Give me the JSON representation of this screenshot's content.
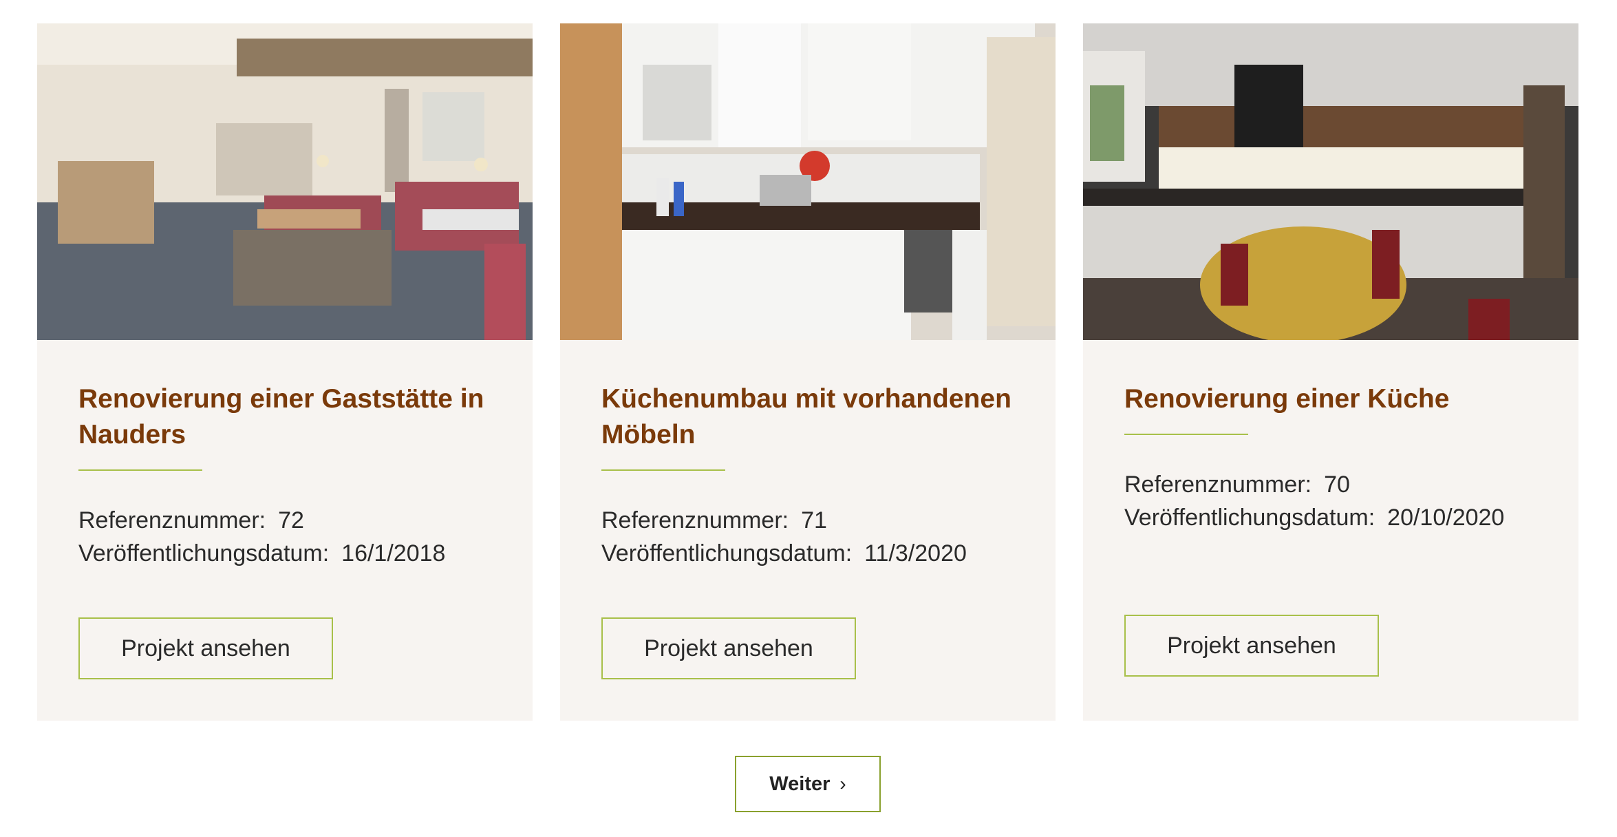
{
  "projects": [
    {
      "title": "Renovierung einer Gaststätte in Nauders",
      "ref_label": "Referenznummer:",
      "ref_value": "72",
      "date_label": "Veröffentlichungsdatum:",
      "date_value": "16/1/2018",
      "button_label": "Projekt ansehen",
      "image_icon": "restaurant-interior-photo"
    },
    {
      "title": "Küchenumbau mit vorhandenen Möbeln",
      "ref_label": "Referenznummer:",
      "ref_value": "71",
      "date_label": "Veröffentlichungsdatum:",
      "date_value": "11/3/2020",
      "button_label": "Projekt ansehen",
      "image_icon": "white-kitchen-photo"
    },
    {
      "title": "Renovierung einer Küche",
      "ref_label": "Referenznummer:",
      "ref_value": "70",
      "date_label": "Veröffentlichungsdatum:",
      "date_value": "20/10/2020",
      "button_label": "Projekt ansehen",
      "image_icon": "dark-kitchen-photo"
    }
  ],
  "pagination": {
    "next_label": "Weiter",
    "next_icon": "chevron-right-icon"
  },
  "colors": {
    "title": "#7a3a0a",
    "accent": "#a8c04a",
    "card_bg": "#f7f4f1"
  }
}
